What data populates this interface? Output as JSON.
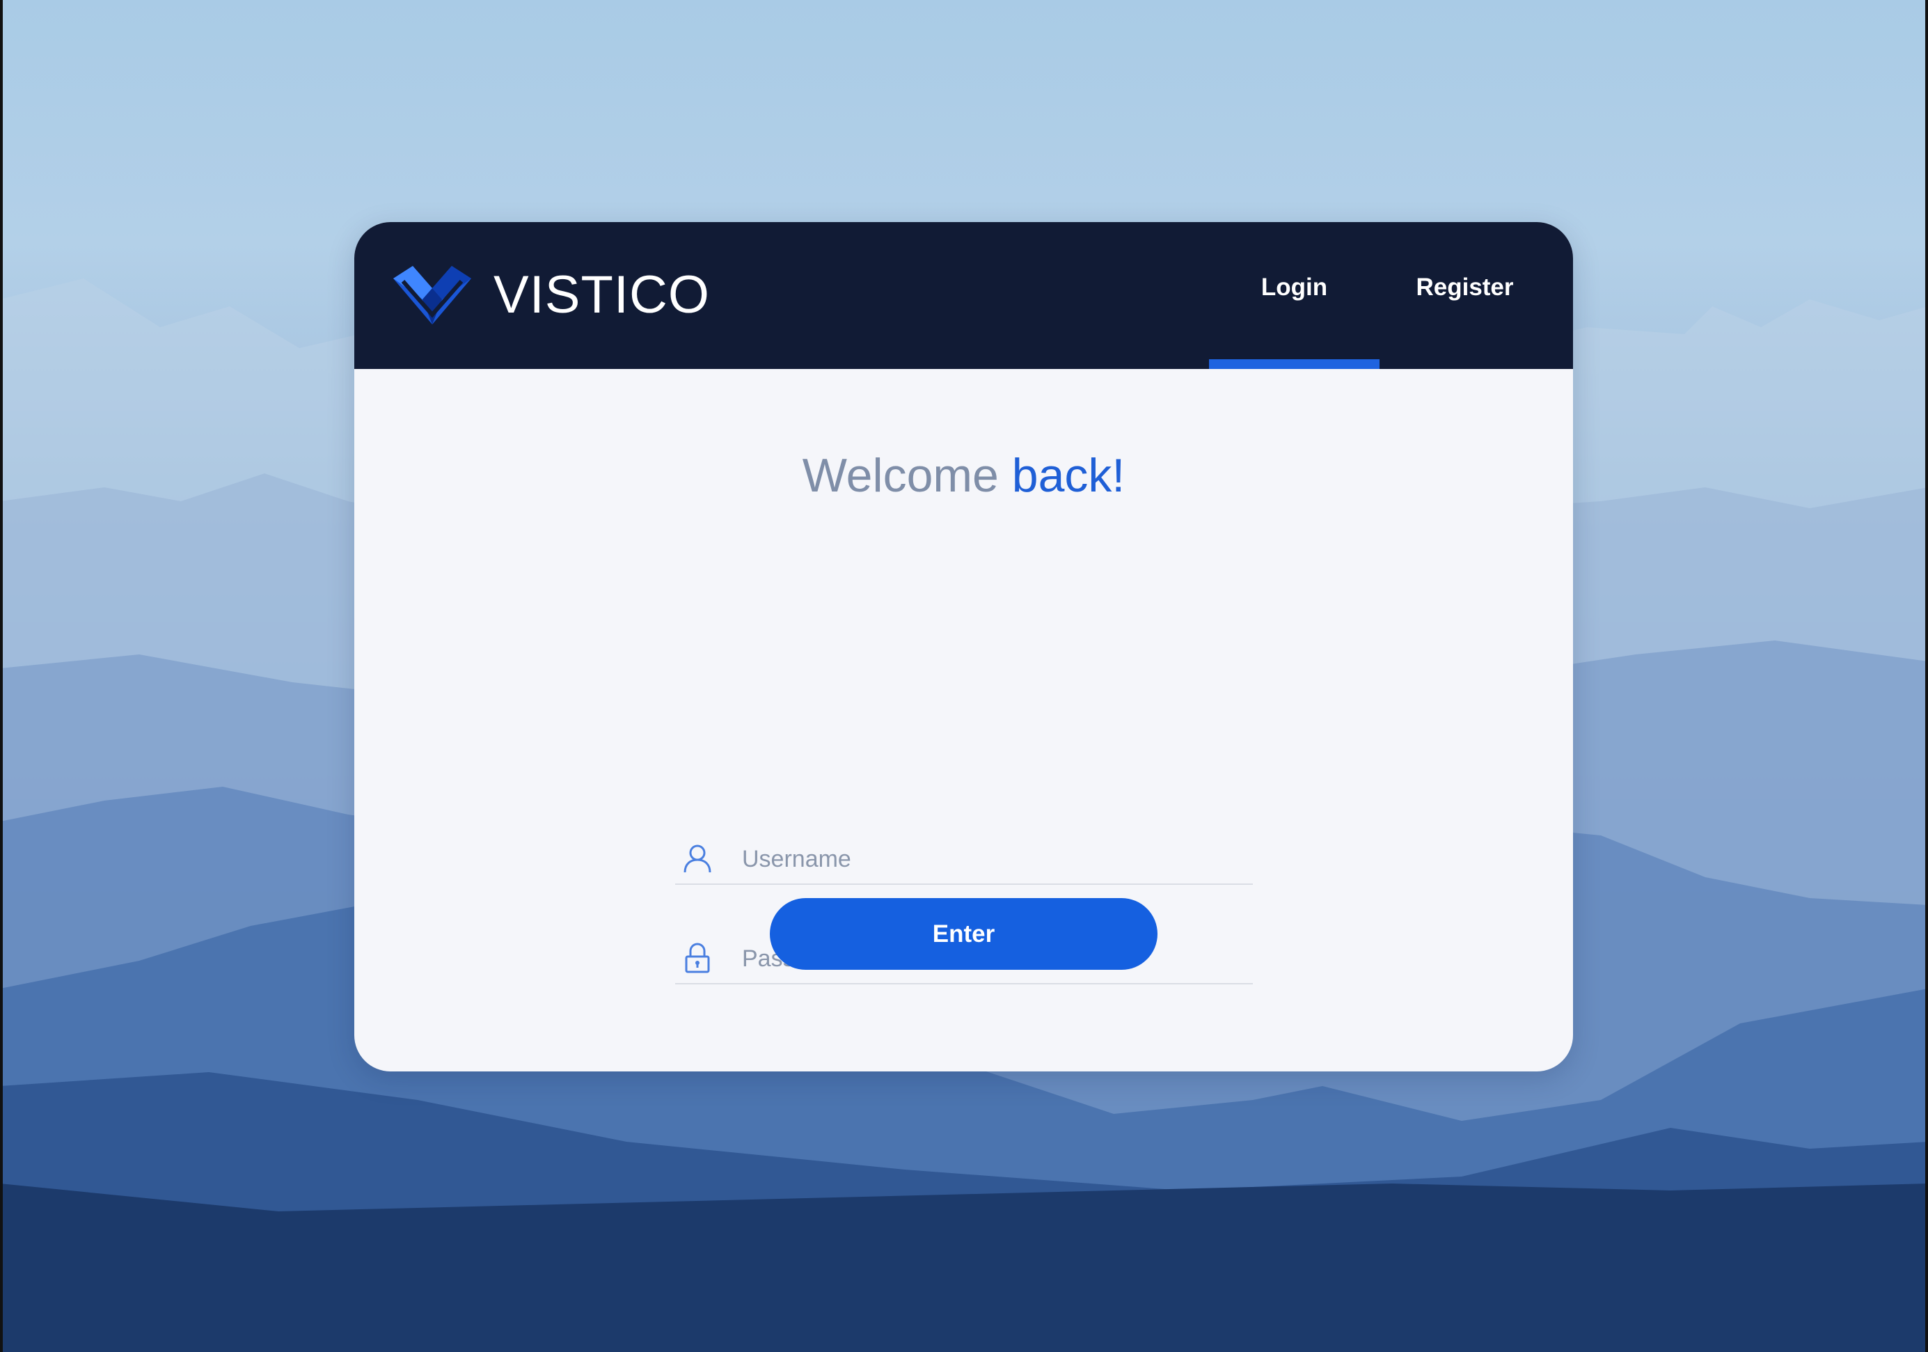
{
  "brand": {
    "name": "VISTICO",
    "logo_icon": "heart-checkmark-logo"
  },
  "nav": {
    "tabs": [
      {
        "label": "Login",
        "active": true
      },
      {
        "label": "Register",
        "active": false
      }
    ]
  },
  "welcome": {
    "text_plain": "Welcome",
    "text_accent": "back!"
  },
  "form": {
    "username": {
      "placeholder": "Username",
      "value": "",
      "icon": "user-icon"
    },
    "password": {
      "placeholder": "Password",
      "value": "",
      "icon": "lock-icon"
    },
    "submit_label": "Enter"
  },
  "colors": {
    "header_bg": "#111b35",
    "accent": "#1560e0",
    "card_bg": "#f5f6fa"
  }
}
